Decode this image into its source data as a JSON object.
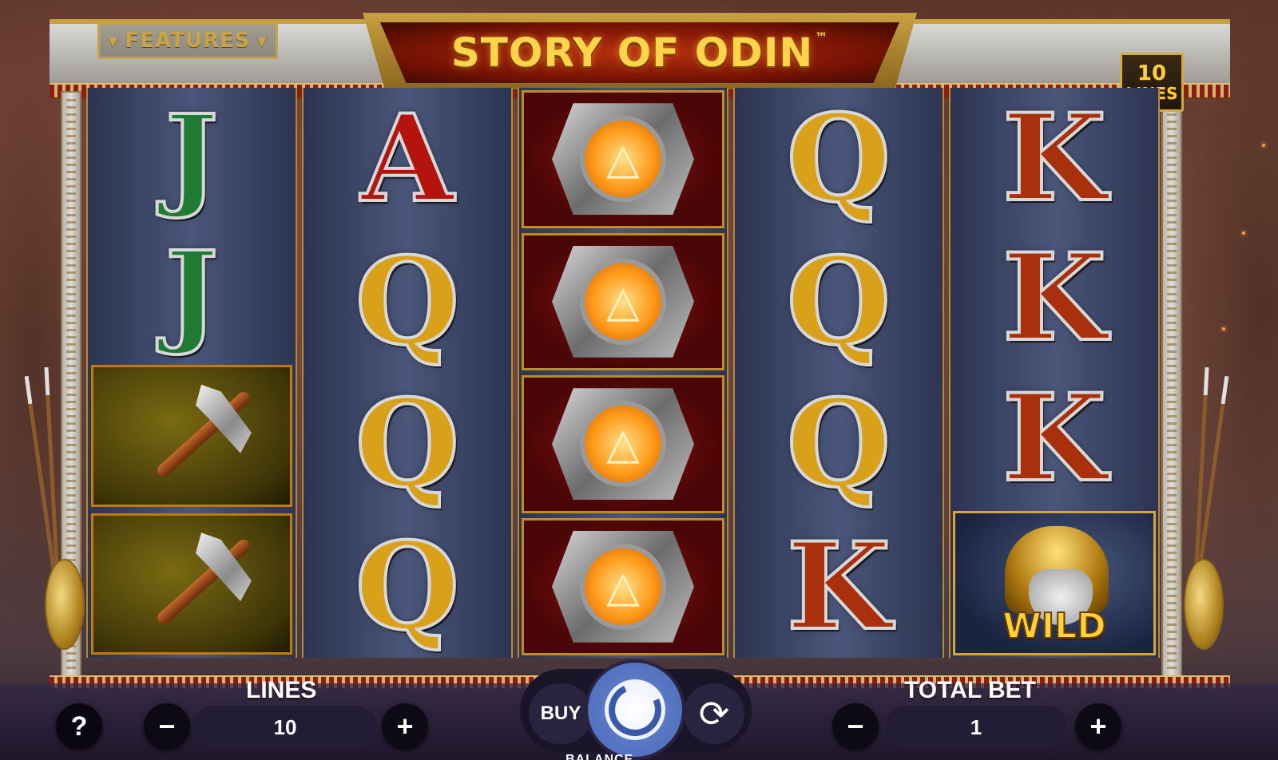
{
  "game": {
    "title": "STORY OF ODIN",
    "title_mark": "™",
    "features_label": "FEATURES",
    "lines_badge": {
      "number": "10",
      "word": "LINES"
    }
  },
  "reels": [
    [
      "J",
      "J",
      "axe",
      "axe"
    ],
    [
      "A",
      "Q",
      "Q",
      "Q"
    ],
    [
      "valknut",
      "valknut",
      "valknut",
      "valknut"
    ],
    [
      "Q",
      "Q",
      "Q",
      "K"
    ],
    [
      "K",
      "K",
      "K",
      "wild"
    ]
  ],
  "wild_label": "WILD",
  "controls": {
    "help_label": "?",
    "lines_label": "LINES",
    "lines_value": "10",
    "total_bet_label": "TOTAL BET",
    "total_bet_value": "1",
    "minus": "−",
    "plus": "+",
    "buy_label": "BUY",
    "autoplay_icon": "⟳",
    "balance_label": "BALANCE"
  },
  "colors": {
    "J": "#1f7a34",
    "A": "#b5140e",
    "Q": "#d9a01a",
    "K": "#a8300d",
    "spin_button": "#4a67b8"
  }
}
